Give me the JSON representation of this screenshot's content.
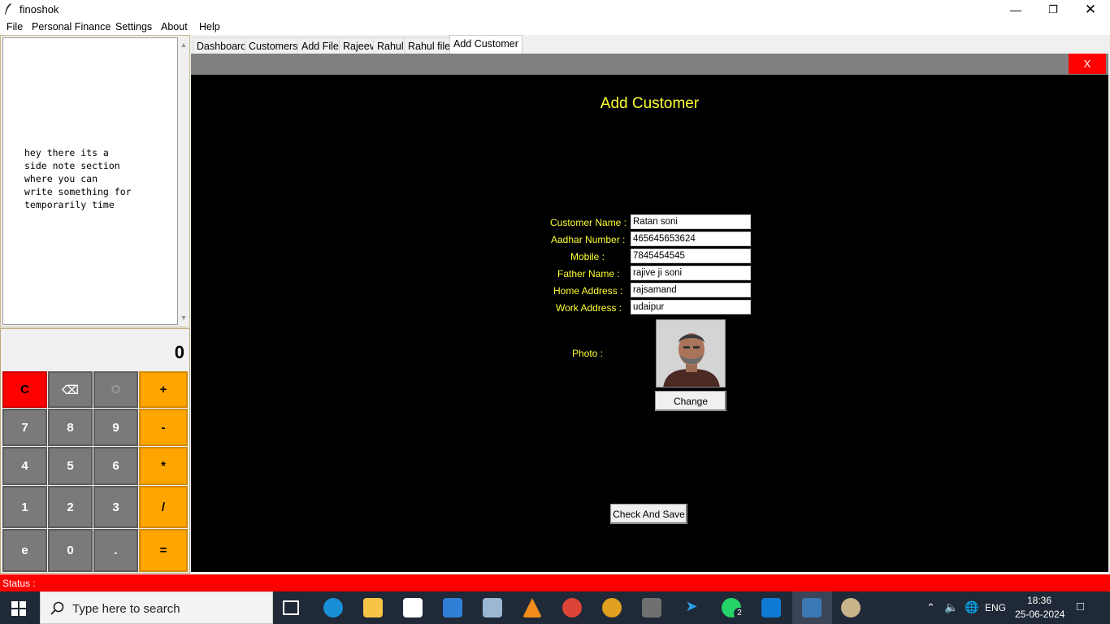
{
  "window": {
    "title": "finoshok",
    "minimize_icon": "minimize-icon",
    "restore_icon": "restore-icon",
    "close_icon": "close-icon"
  },
  "menu": [
    "File",
    "Personal Finance",
    "Settings",
    "About",
    "Help"
  ],
  "notes": {
    "text": "hey there its a\nside note section\nwhere you can\nwrite something for\ntemporarily time"
  },
  "calculator": {
    "display": "0",
    "keys": [
      "C",
      "⌫",
      "O",
      "+",
      "7",
      "8",
      "9",
      "-",
      "4",
      "5",
      "6",
      "*",
      "1",
      "2",
      "3",
      "/",
      "e",
      "0",
      ".",
      "="
    ]
  },
  "tabs": [
    "Dashboard",
    "Customers",
    "Add File",
    "Rajeev",
    "Rahul",
    "Rahul file",
    "Add Customer"
  ],
  "active_tab": "Add Customer",
  "close_label": "X",
  "form": {
    "title": "Add Customer",
    "fields": [
      {
        "label": "Customer Name :",
        "value": "Ratan soni"
      },
      {
        "label": "Aadhar Number :",
        "value": "465645653624"
      },
      {
        "label": "Mobile :",
        "value": "7845454545"
      },
      {
        "label": "Father Name :",
        "value": "rajive ji soni"
      },
      {
        "label": "Home Address :",
        "value": "rajsamand"
      },
      {
        "label": "Work Address :",
        "value": "udaipur"
      }
    ],
    "photo_label": "Photo :",
    "change_label": "Change",
    "save_label": "Check And Save"
  },
  "status": {
    "text": "Status :"
  },
  "taskbar": {
    "search_placeholder": "Type here to search",
    "language": "ENG",
    "time": "18:36",
    "date": "25-06-2024",
    "whatsapp_badge": "2"
  },
  "colors": {
    "accent_yellow": "#ffff33",
    "status_red": "#ff0000",
    "calc_orange": "#ffa500",
    "taskbar": "#1f2937"
  }
}
